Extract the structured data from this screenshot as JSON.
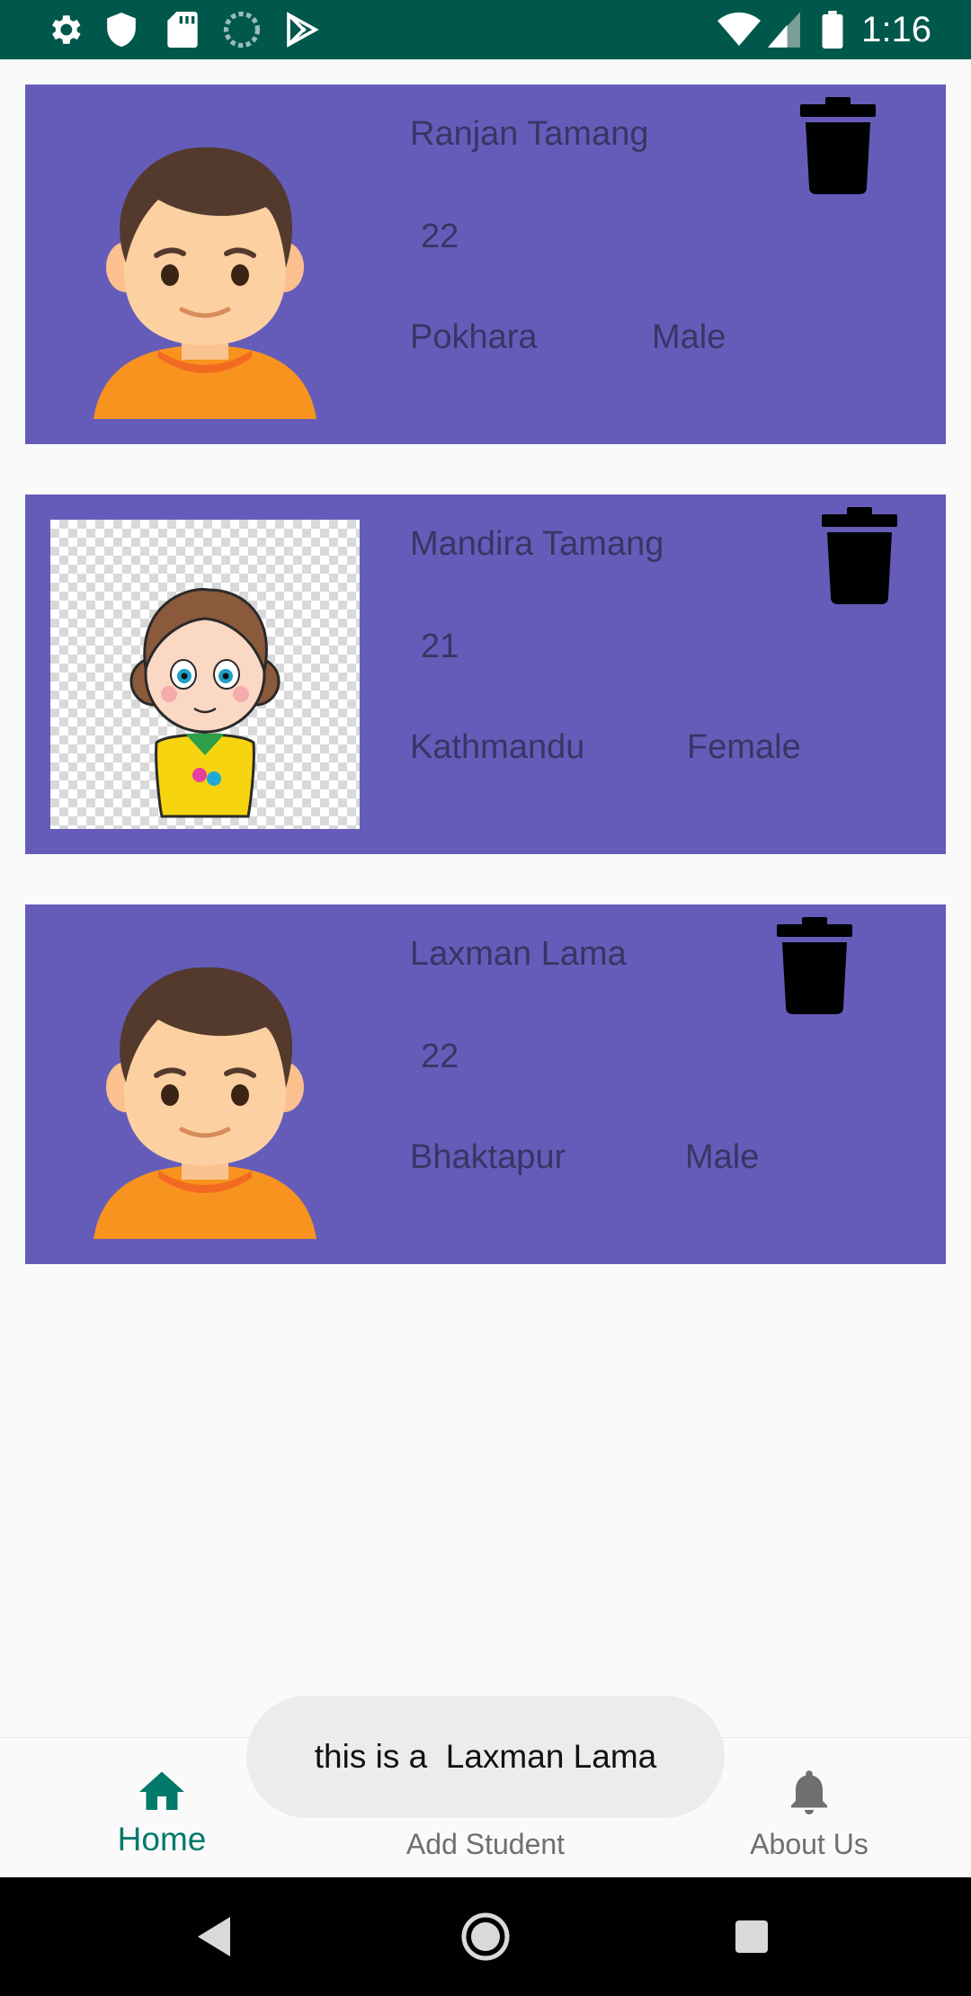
{
  "status_bar": {
    "time": "1:16",
    "left_icons": [
      "settings-icon",
      "shield-icon",
      "sd-card-icon",
      "sync-icon",
      "play-store-icon"
    ],
    "right_icons": [
      "wifi-icon",
      "signal-icon",
      "battery-icon"
    ]
  },
  "students": [
    {
      "name": "Ranjan Tamang",
      "age": "22",
      "city": "Pokhara",
      "gender": "Male",
      "avatar": "boy-avatar"
    },
    {
      "name": "Mandira Tamang",
      "age": "21",
      "city": "Kathmandu",
      "gender": "Female",
      "avatar": "girl-avatar"
    },
    {
      "name": "Laxman Lama",
      "age": "22",
      "city": "Bhaktapur",
      "gender": "Male",
      "avatar": "boy-avatar"
    }
  ],
  "colors": {
    "card": "#655cba",
    "status_bar": "#00574b",
    "nav_active": "#00796b",
    "toast_bg": "#ececec"
  },
  "bottom_nav": {
    "items": [
      {
        "label": "Home",
        "icon": "home-icon",
        "active": true
      },
      {
        "label": "Add Student",
        "icon": "add-person-icon",
        "active": false
      },
      {
        "label": "About Us",
        "icon": "bell-icon",
        "active": false
      }
    ]
  },
  "toast": {
    "text": "this is a  Laxman Lama"
  },
  "system_nav": [
    "back-icon",
    "home-circle-icon",
    "recents-icon"
  ]
}
